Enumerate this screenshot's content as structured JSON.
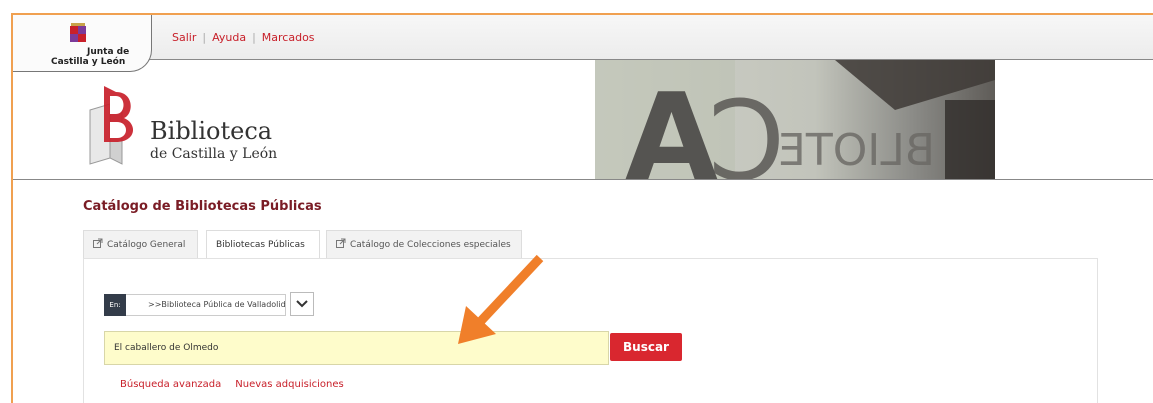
{
  "header": {
    "logo_line1": "Junta de",
    "logo_line2": "Castilla y León",
    "links": [
      "Salir",
      "Ayuda",
      "Marcados"
    ],
    "separator": "|"
  },
  "brand": {
    "name": "Biblioteca",
    "subtitle": "de Castilla y León"
  },
  "catalog": {
    "title": "Catálogo de Bibliotecas Públicas",
    "tabs": [
      {
        "label": "Catálogo General",
        "external": true
      },
      {
        "label": "Bibliotecas Públicas",
        "external": false,
        "active": true
      },
      {
        "label": "Catálogo de Colecciones especiales",
        "external": true
      }
    ]
  },
  "search": {
    "scope_badge": "En:",
    "scope_value": ">>Biblioteca Pública de Valladolid",
    "query": "El caballero de Olmedo",
    "button": "Buscar",
    "links": [
      "Búsqueda avanzada",
      "Nuevas adquisiciones"
    ]
  },
  "colors": {
    "accent_red": "#c8202a",
    "button_red": "#d9272f",
    "title_maroon": "#7a1c25",
    "annotation_orange": "#f07f2a",
    "input_yellow": "#fefccb"
  }
}
